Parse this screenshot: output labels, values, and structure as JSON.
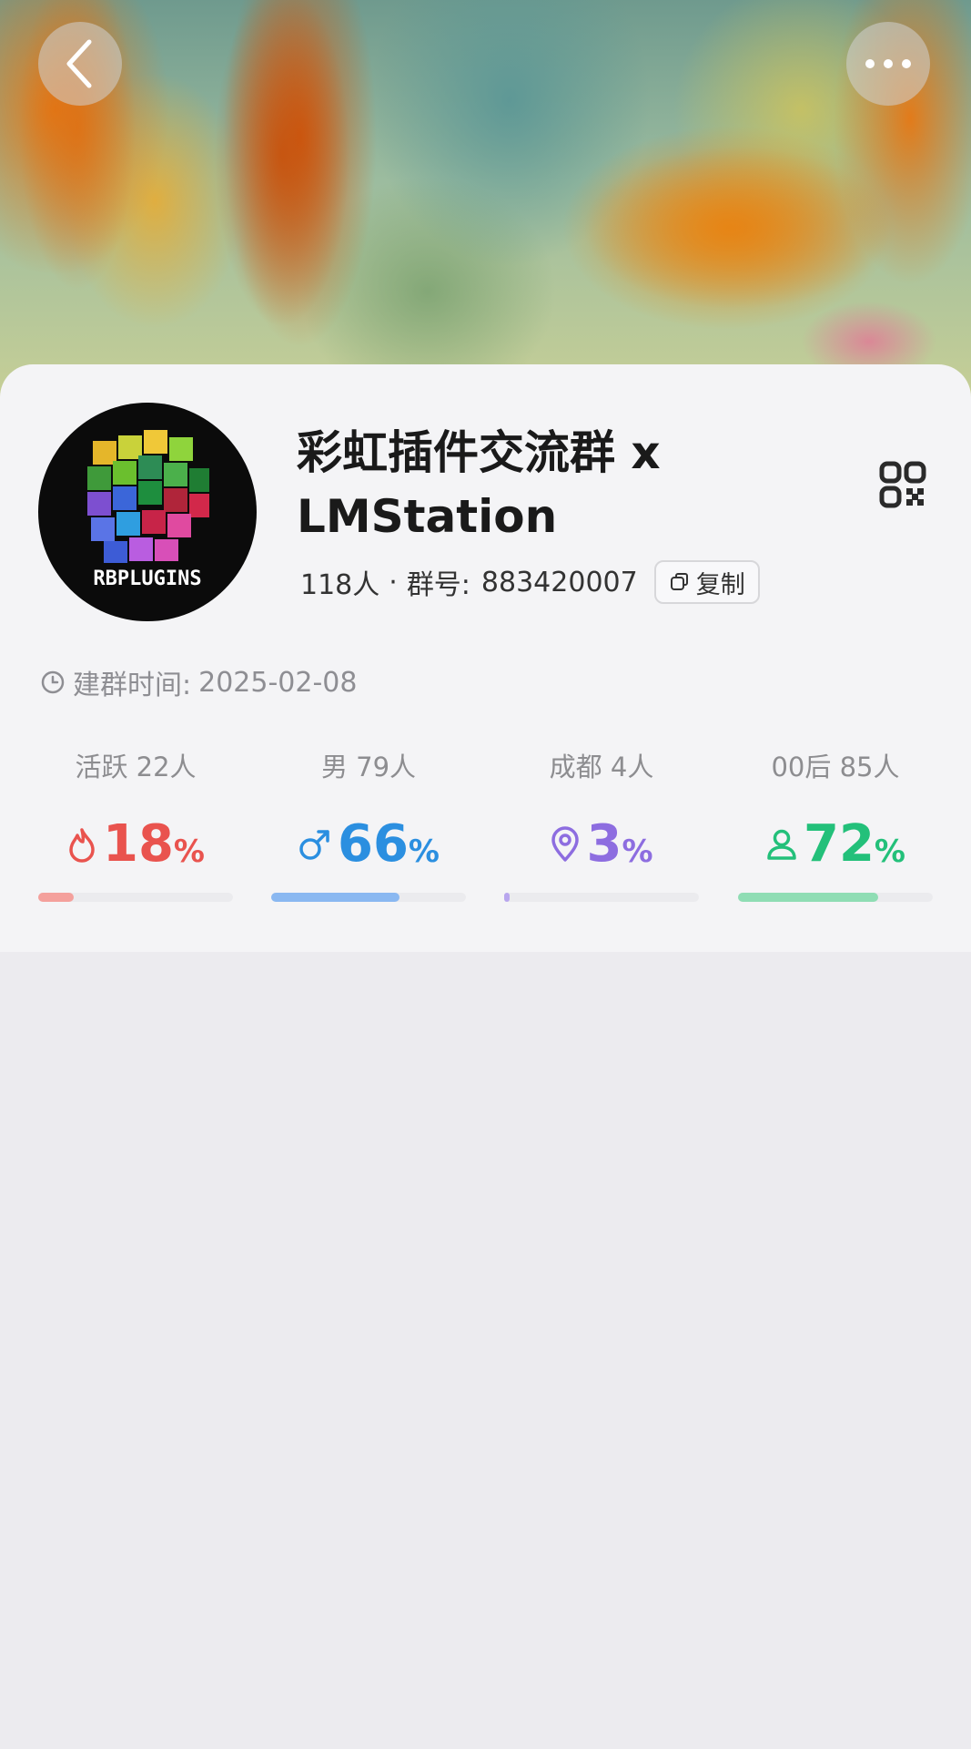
{
  "group": {
    "name": "彩虹插件交流群 x LMStation",
    "member_count": "118人",
    "separator": "·",
    "id_label": "群号:",
    "id_value": "883420007",
    "copy_label": "复制",
    "avatar_text": "RBPLUGINS"
  },
  "created": {
    "label": "建群时间:",
    "value": "2025-02-08"
  },
  "stats": [
    {
      "label": "活跃 22人",
      "value": "18",
      "unit": "%",
      "fraction": 0.18,
      "color": "#e9534e",
      "bar_color": "#f4a09c",
      "icon": "flame-icon"
    },
    {
      "label": "男 79人",
      "value": "66",
      "unit": "%",
      "fraction": 0.66,
      "color": "#2b8fe0",
      "bar_color": "#8ab8f1",
      "icon": "male-icon"
    },
    {
      "label": "成都 4人",
      "value": "3",
      "unit": "%",
      "fraction": 0.03,
      "color": "#8d6de0",
      "bar_color": "#b8a6ee",
      "icon": "location-icon"
    },
    {
      "label": "00后 85人",
      "value": "72",
      "unit": "%",
      "fraction": 0.72,
      "color": "#23c07a",
      "bar_color": "#8fddb4",
      "icon": "person-icon"
    }
  ]
}
